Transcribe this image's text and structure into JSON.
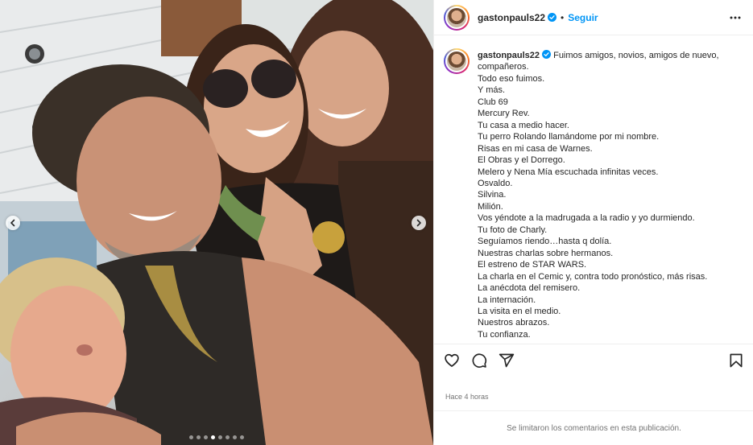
{
  "post": {
    "username": "gastonpauls22",
    "separator": "•",
    "follow_label": "Seguir",
    "time_ago": "Hace 4 horas",
    "comments_disabled": "Se limitaron los comentarios en esta publicación."
  },
  "caption": {
    "lines": [
      "Fuimos amigos, novios, amigos de nuevo,",
      "compañeros.",
      "Todo eso fuimos.",
      "Y más.",
      "Club 69",
      "Mercury Rev.",
      "Tu casa a medio hacer.",
      "Tu perro Rolando llamándome por mi nombre.",
      "Risas en mi casa de Warnes.",
      "El Obras y el Dorrego.",
      "Melero y Nena Mía escuchada infinitas veces.",
      "Osvaldo.",
      "Silvina.",
      "Milión.",
      "Vos yéndote a la madrugada a la radio y yo durmiendo.",
      "Tu foto de Charly.",
      "Seguíamos riendo…hasta q dolía.",
      "Nuestras charlas sobre hermanos.",
      "El estreno de STAR WARS.",
      "La charla en el Cemic y, contra todo pronóstico, más risas.",
      "La anécdota del remisero.",
      "La internación.",
      "La visita en el medio.",
      "Nuestros abrazos.",
      "Tu confianza."
    ]
  },
  "carousel": {
    "slide_count": 8,
    "active_index": 3
  },
  "icons": {
    "verified": "verified-badge-icon",
    "more": "more-options-icon",
    "like": "heart-icon",
    "comment": "comment-icon",
    "share": "share-icon",
    "save": "bookmark-icon",
    "prev": "chevron-left-icon",
    "next": "chevron-right-icon"
  },
  "colors": {
    "link_blue": "#0095f6",
    "text": "#262626",
    "secondary_text": "#737373",
    "divider": "#efefef"
  }
}
